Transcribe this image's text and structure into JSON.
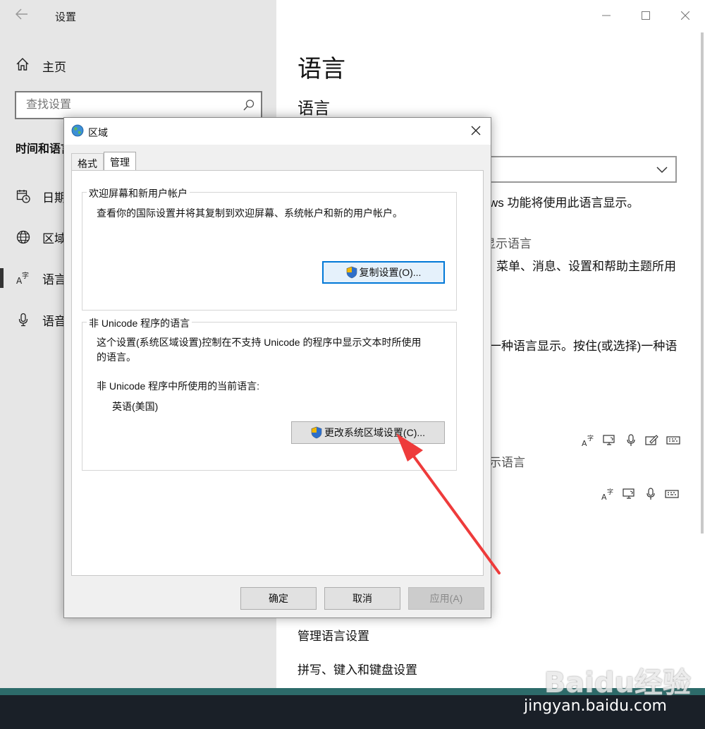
{
  "settings": {
    "title": "设置",
    "home": "主页",
    "search_placeholder": "查找设置",
    "section_title": "时间和语言",
    "nav": [
      {
        "label": "日期和时间",
        "icon": "calendar-clock-icon"
      },
      {
        "label": "区域",
        "icon": "globe-icon"
      },
      {
        "label": "语言",
        "icon": "language-icon"
      },
      {
        "label": "语音",
        "icon": "microphone-icon"
      }
    ],
    "main": {
      "page_title": "语言",
      "sub_title": "语言",
      "text_1": "ws 功能将使用此语言显示。",
      "text_2": "显示语言",
      "text_3": "菜单、消息、设置和帮助主题所用",
      "text_4": "一种语言显示。按住(或选择)一种语",
      "text_5": "示语言",
      "link_1": "管理语言设置",
      "link_2": "拼写、键入和键盘设置"
    },
    "feature_icons": [
      "display-language-icon",
      "text-to-speech-icon",
      "speech-icon",
      "handwriting-icon",
      "keyboard-icon"
    ]
  },
  "dialog": {
    "title": "区域",
    "tabs": [
      "格式",
      "管理"
    ],
    "active_tab": "管理",
    "welcome_group": {
      "legend": "欢迎屏幕和新用户帐户",
      "text": "查看你的国际设置并将其复制到欢迎屏幕、系统帐户和新的用户帐户。",
      "button": "复制设置(O)..."
    },
    "unicode_group": {
      "legend": "非 Unicode 程序的语言",
      "text_line1": "这个设置(系统区域设置)控制在不支持 Unicode 的程序中显示文本时所使用",
      "text_line2": "的语言。",
      "current_label": "非 Unicode 程序中所使用的当前语言:",
      "current_value": "英语(美国)",
      "button": "更改系统区域设置(C)..."
    },
    "ok": "确定",
    "cancel": "取消",
    "apply": "应用(A)"
  },
  "watermark": {
    "logo": "Baidu经验",
    "url": "jingyan.baidu.com"
  },
  "colors": {
    "arrow": "#ee3b3b",
    "focus": "#0078d7"
  }
}
